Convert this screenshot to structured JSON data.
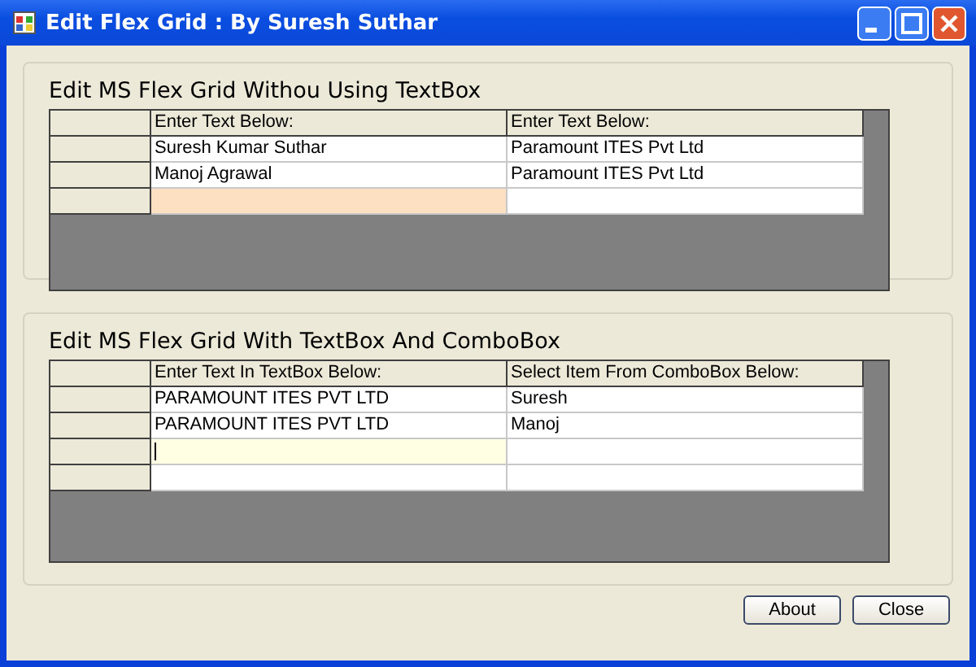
{
  "window": {
    "title": "Edit Flex Grid : By Suresh Suthar"
  },
  "groups": [
    {
      "title": "Edit MS Flex Grid Withou Using TextBox",
      "kind": "plain",
      "columns": [
        "Enter Text Below:",
        "Enter Text Below:"
      ],
      "rows": [
        {
          "cells": [
            {
              "text": "Suresh Kumar Suthar",
              "selected": false
            },
            {
              "text": "Paramount ITES Pvt Ltd",
              "selected": false
            }
          ]
        },
        {
          "cells": [
            {
              "text": "Manoj Agrawal",
              "selected": false
            },
            {
              "text": "Paramount ITES Pvt Ltd",
              "selected": false
            }
          ]
        },
        {
          "cells": [
            {
              "selected": true
            },
            {
              "selected": false
            }
          ]
        }
      ]
    },
    {
      "title": "Edit MS Flex Grid With TextBox And ComboBox",
      "kind": "textbox",
      "columns": [
        "Enter Text In TextBox Below:",
        "Select Item From ComboBox Below:"
      ],
      "rows": [
        {
          "cells": [
            {
              "text": "PARAMOUNT ITES PVT LTD",
              "selected": false
            },
            {
              "text": "Suresh",
              "selected": false
            }
          ]
        },
        {
          "cells": [
            {
              "text": "PARAMOUNT ITES PVT LTD",
              "selected": false
            },
            {
              "text": "Manoj",
              "selected": false
            }
          ]
        },
        {
          "cells": [
            {
              "selected": true
            },
            {
              "selected": false
            }
          ]
        },
        {
          "cells": [
            {
              "selected": false
            },
            {
              "selected": false
            }
          ]
        }
      ]
    }
  ],
  "buttons": [
    "About",
    "Close"
  ]
}
